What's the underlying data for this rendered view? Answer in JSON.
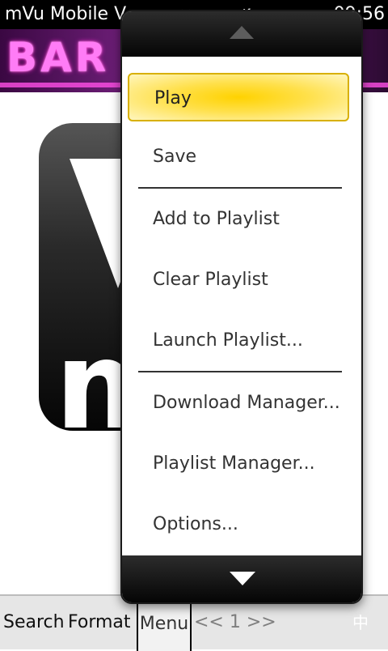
{
  "status_bar": {
    "title": "mVu Mobile V",
    "icons": [
      "close-icon",
      "signal-icon",
      "wifi-icon",
      "mute-icon",
      "battery-icon"
    ],
    "time": "09:56"
  },
  "banner": {
    "text": "BAR"
  },
  "menu": {
    "items": [
      {
        "label": "Play",
        "selected": true
      },
      {
        "label": "Save"
      },
      {
        "label": "Add to Playlist"
      },
      {
        "label": "Clear Playlist"
      },
      {
        "label": "Launch Playlist..."
      },
      {
        "label": "Download Manager..."
      },
      {
        "label": "Playlist Manager..."
      },
      {
        "label": "Options..."
      }
    ]
  },
  "toolbar": {
    "search": "Search",
    "format": "Format",
    "menu": "Menu",
    "pager": "<< 1 >>",
    "ime": "中"
  },
  "colors": {
    "menu_highlight": "#ffd200",
    "popup_bar": "#050505",
    "toolbar_bg": "#e6e6e6"
  }
}
